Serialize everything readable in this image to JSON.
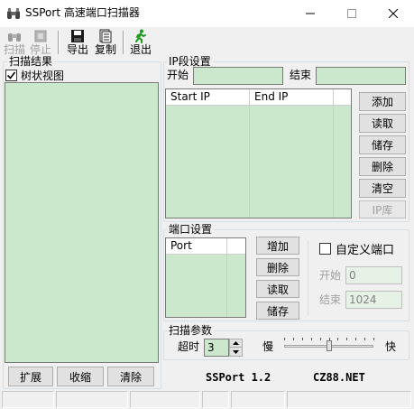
{
  "window": {
    "title": "SSPort 高速端口扫描器"
  },
  "toolbar": {
    "items": [
      {
        "label": "扫描",
        "enabled": false
      },
      {
        "label": "停止",
        "enabled": false
      },
      {
        "label": "导出",
        "enabled": true
      },
      {
        "label": "复制",
        "enabled": true
      },
      {
        "label": "退出",
        "enabled": true
      }
    ]
  },
  "scan_results": {
    "group_title": "扫描结果",
    "tree_view_label": "树状视图",
    "tree_view_checked": true,
    "buttons": {
      "expand": "扩展",
      "collapse": "收缩",
      "clear": "清除"
    }
  },
  "ip_range": {
    "group_title": "IP段设置",
    "start_label": "开始",
    "start_value": "",
    "end_label": "结束",
    "end_value": "",
    "columns": [
      "Start IP",
      "End IP"
    ],
    "buttons": {
      "add": "添加",
      "read": "读取",
      "save": "储存",
      "delete": "删除",
      "clear": "清空",
      "ip_lib": "IP库"
    }
  },
  "port_settings": {
    "group_title": "端口设置",
    "columns": [
      "Port"
    ],
    "buttons": {
      "add": "增加",
      "delete": "删除",
      "read": "读取",
      "save": "储存"
    },
    "custom_port_label": "自定义端口",
    "custom_port_checked": false,
    "start_label": "开始",
    "start_value": "0",
    "end_label": "结束",
    "end_value": "1024"
  },
  "scan_params": {
    "group_title": "扫描参数",
    "timeout_label": "超时",
    "timeout_value": "3",
    "slow_label": "慢",
    "fast_label": "快",
    "speed_fraction": 0.5
  },
  "footer": {
    "version": "SSPort 1.2",
    "site": "CZ88.NET"
  },
  "colors": {
    "panel_green": "#cce8cc",
    "window_bg": "#f0f0f0",
    "button_face": "#e1e1e1"
  }
}
